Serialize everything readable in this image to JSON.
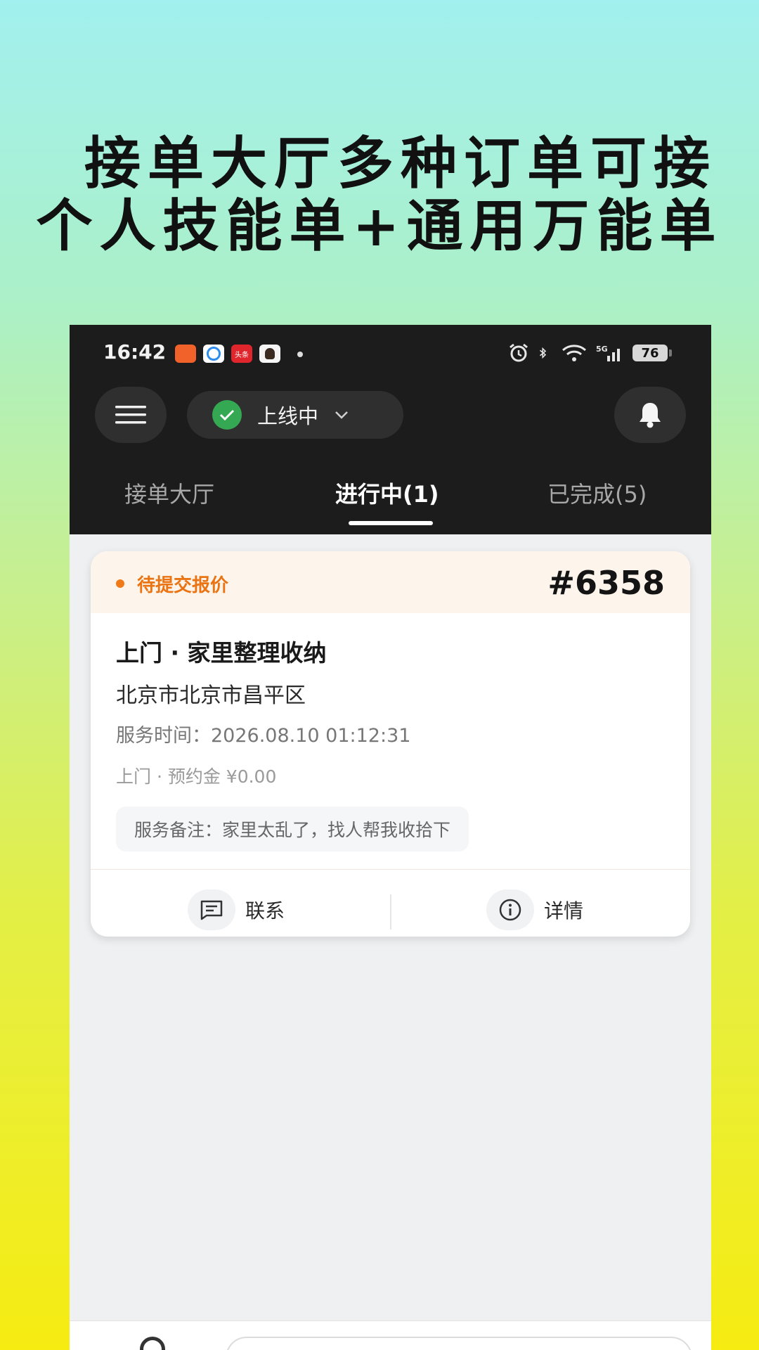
{
  "promo": {
    "line1": "接单大厅多种订单可接",
    "line2": "个人技能单+通用万能单"
  },
  "status_bar": {
    "time": "16:42",
    "app_icon_label": "头条",
    "battery": "76",
    "network": "5G"
  },
  "header": {
    "menu_icon": "menu-icon",
    "online_status": "上线中",
    "bell_icon": "bell-icon",
    "accent_green": "#35a853"
  },
  "tabs": [
    {
      "label": "接单大厅",
      "active": false
    },
    {
      "label": "进行中(1)",
      "active": true
    },
    {
      "label": "已完成(5)",
      "active": false
    }
  ],
  "order": {
    "status": "待提交报价",
    "status_color": "#ea7413",
    "number": "#6358",
    "title": "上门 · 家里整理收纳",
    "address": "北京市北京市昌平区",
    "service_time": "服务时间：2026.08.10 01:12:31",
    "deposit": "上门 · 预约金 ¥0.00",
    "remark": "服务备注：家里太乱了，找人帮我收拾下",
    "actions": {
      "contact": "联系",
      "detail": "详情"
    }
  }
}
